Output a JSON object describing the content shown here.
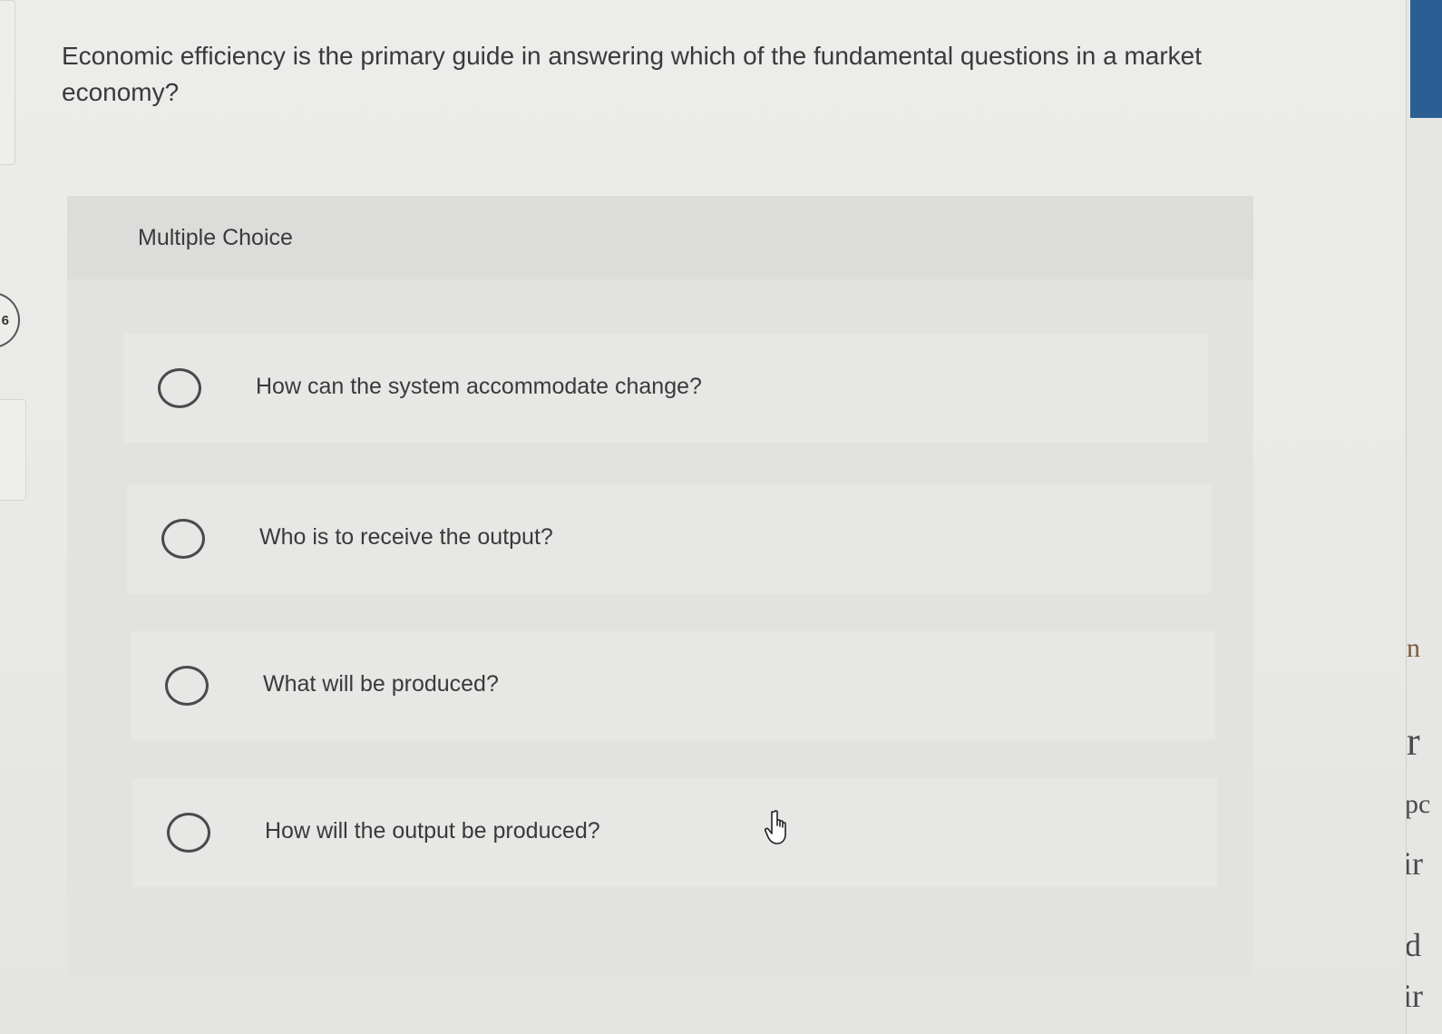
{
  "question": {
    "number": "6",
    "text": "Economic efficiency is the primary guide in answering which of the fundamental questions in a market economy?"
  },
  "section": {
    "label": "Multiple Choice"
  },
  "options": [
    {
      "text": "How can the system accommodate change?"
    },
    {
      "text": "Who is to receive the output?"
    },
    {
      "text": "What will be produced?"
    },
    {
      "text": "How will the output be produced?"
    }
  ],
  "right_edge_fragments": [
    "n",
    "r",
    "pc",
    "ir",
    "d",
    "ir"
  ],
  "colors": {
    "page_background": "#eaeae8",
    "panel_background": "#e2e2e0",
    "text": "#3a3a3a",
    "accent_blue": "#2b5f93"
  },
  "icons": {
    "cursor": "hand-pointer-icon",
    "radio": "radio-unselected-icon"
  }
}
